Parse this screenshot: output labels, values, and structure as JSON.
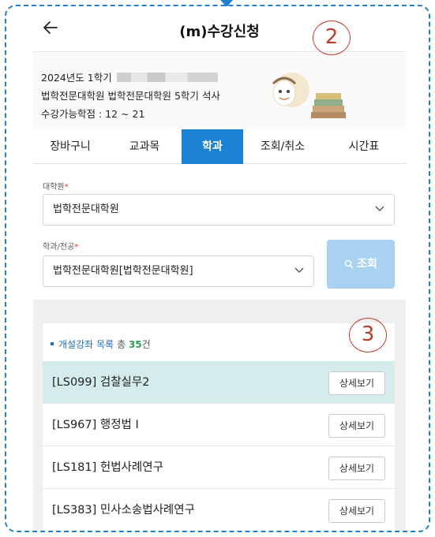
{
  "header": {
    "title": "(m)수강신청"
  },
  "callouts": {
    "one": "2",
    "two": "3"
  },
  "info": {
    "line1": "2024년도 1학기",
    "line2": "법학전문대학원 법학전문대학원 5학기 석사",
    "line3": "수강가능학점 : 12 ~ 21"
  },
  "tabs": [
    {
      "label": "장바구니"
    },
    {
      "label": "교과목"
    },
    {
      "label": "학과",
      "active": true
    },
    {
      "label": "조회/취소"
    },
    {
      "label": "시간표"
    }
  ],
  "form": {
    "grad_label": "대학원",
    "grad_value": "법학전문대학원",
    "dept_label": "학과/전공",
    "dept_value": "법학전문대학원[법학전문대학원]",
    "required_mark": "*",
    "search_label": "조회"
  },
  "list": {
    "heading": "개설강좌 목록",
    "total_label": "총",
    "total_count": "35",
    "unit": "건",
    "detail_label": "상세보기",
    "rows": [
      {
        "title": "[LS099] 검찰실무2",
        "selected": true
      },
      {
        "title": "[LS967] 행정법 I"
      },
      {
        "title": "[LS181] 헌법사례연구"
      },
      {
        "title": "[LS383] 민사소송법사례연구"
      }
    ]
  },
  "colors": {
    "accent": "#1b82d4",
    "frame": "#1f7fd0",
    "callout": "#c0392b",
    "selected_row": "#d4ecec",
    "search_button": "#a9d2f1"
  }
}
